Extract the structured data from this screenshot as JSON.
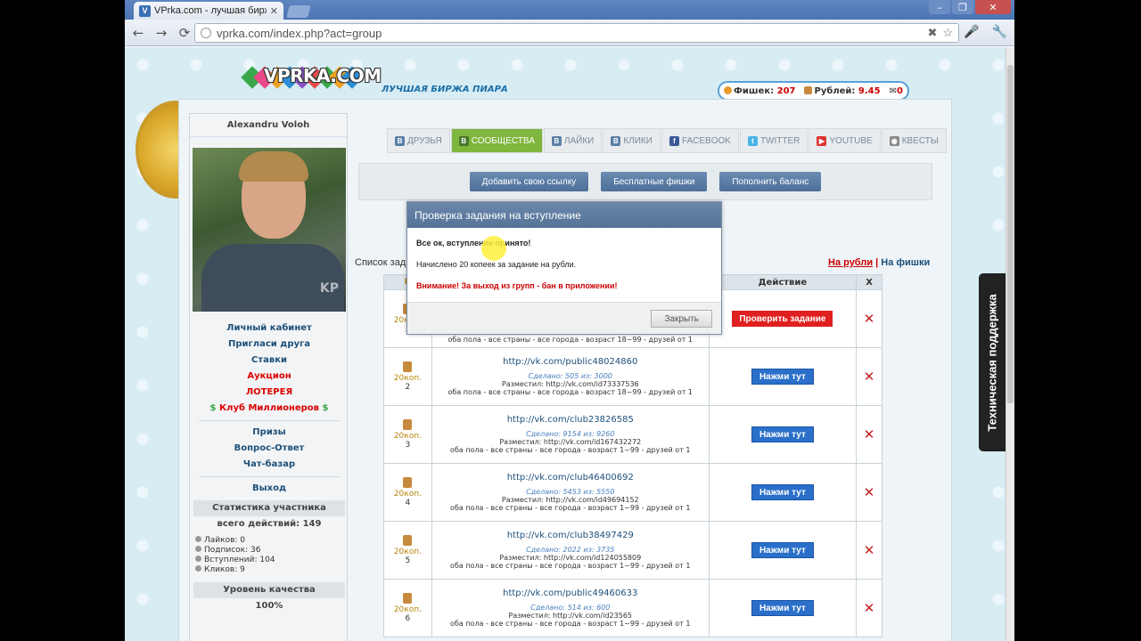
{
  "browser": {
    "tab_title": "VPrka.com - лучшая биржа от",
    "tab_favicon": "V",
    "url": "vprka.com/index.php?act=group"
  },
  "site": {
    "logo": "VPRKA.COM",
    "slogan": "ЛУЧШАЯ БИРЖА ПИАРА",
    "balance": {
      "chips_label": "Фишек:",
      "chips_value": "207",
      "rubles_label": "Рублей:",
      "rubles_value": "9.45",
      "messages": "0"
    }
  },
  "sidebar": {
    "username": "Alexandru Voloh",
    "menu": [
      {
        "label": "Личный кабинет",
        "style": "normal"
      },
      {
        "label": "Пригласи друга",
        "style": "normal"
      },
      {
        "label": "Ставки",
        "style": "normal"
      },
      {
        "label": "Аукцион",
        "style": "red"
      },
      {
        "label": "ЛОТЕРЕЯ",
        "style": "red"
      },
      {
        "label": "Клуб Миллионеров",
        "style": "red"
      }
    ],
    "menu2": [
      "Призы",
      "Вопрос-Ответ",
      "Чат-базар"
    ],
    "logout": "Выход",
    "stats_title": "Статистика участника",
    "stats_total": "всего действий: 149",
    "stats": [
      "Лайков: 0",
      "Подписок: 36",
      "Вступлений: 104",
      "Кликов: 9"
    ],
    "quality_title": "Уровень качества",
    "quality_value": "100%"
  },
  "tabs": [
    {
      "label": "ДРУЗЬЯ",
      "active": false
    },
    {
      "label": "СООБЩЕСТВА",
      "active": true
    },
    {
      "label": "ЛАЙКИ",
      "active": false
    },
    {
      "label": "КЛИКИ",
      "active": false
    },
    {
      "label": "FACEBOOK",
      "active": false
    },
    {
      "label": "TWITTER",
      "active": false
    },
    {
      "label": "YOUTUBE",
      "active": false
    },
    {
      "label": "КВЕСТЫ",
      "active": false
    }
  ],
  "actions": {
    "add_link": "Добавить свою ссылку",
    "free_chips": "Бесплатные фишки",
    "top_up": "Пополнить баланс"
  },
  "list": {
    "title": "Список зад",
    "currency_rub": "На рубли",
    "currency_chips": "На фишки",
    "separator": "|",
    "col_num": "N",
    "col_action": "Действие",
    "col_x": "X"
  },
  "tasks": [
    {
      "price": "20коп.",
      "num": "1",
      "url": "",
      "done": "",
      "by": "",
      "filter": "оба пола - все страны - все города - возраст 18~99 - друзей от 1",
      "action": "Проверить задание",
      "action_type": "red"
    },
    {
      "price": "20коп.",
      "num": "2",
      "url": "http://vk.com/public48024860",
      "done": "Сделано: 505 из: 3000",
      "by": "Разместил: http://vk.com/id73337536",
      "filter": "оба пола - все страны - все города - возраст 18~99 - друзей от 1",
      "action": "Нажми тут",
      "action_type": "blue"
    },
    {
      "price": "20коп.",
      "num": "3",
      "url": "http://vk.com/club23826585",
      "done": "Сделано: 9154 из: 9260",
      "by": "Разместил: http://vk.com/id167432272",
      "filter": "оба пола - все страны - все города - возраст 1~99 - друзей от 1",
      "action": "Нажми тут",
      "action_type": "blue"
    },
    {
      "price": "20коп.",
      "num": "4",
      "url": "http://vk.com/club46400692",
      "done": "Сделано: 5453 из: 5550",
      "by": "Разместил: http://vk.com/id49694152",
      "filter": "оба пола - все страны - все города - возраст 1~99 - друзей от 1",
      "action": "Нажми тут",
      "action_type": "blue"
    },
    {
      "price": "20коп.",
      "num": "5",
      "url": "http://vk.com/club38497429",
      "done": "Сделано: 2022 из: 3735",
      "by": "Разместил: http://vk.com/id124055809",
      "filter": "оба пола - все страны - все города - возраст 1~99 - друзей от 1",
      "action": "Нажми тут",
      "action_type": "blue"
    },
    {
      "price": "20коп.",
      "num": "6",
      "url": "http://vk.com/public49460633",
      "done": "Сделано: 514 из: 600",
      "by": "Разместил: http://vk.com/id23565",
      "filter": "оба пола - все страны - все города - возраст 1~99 - друзей от 1",
      "action": "Нажми тут",
      "action_type": "blue"
    }
  ],
  "modal": {
    "title": "Проверка задания на вступление",
    "ok": "Все ок, вступление принято!",
    "info": "Начислено 20 копеек за задание на рубли.",
    "warning": "Внимание! За выход из групп - бан в приложении!",
    "close": "Закрыть"
  },
  "support": "Техническая поддержка",
  "colors": {
    "accent_green": "#7fb63e",
    "button_blue": "#2a6fc9",
    "button_red": "#e0201f",
    "header_blue": "#557397"
  }
}
